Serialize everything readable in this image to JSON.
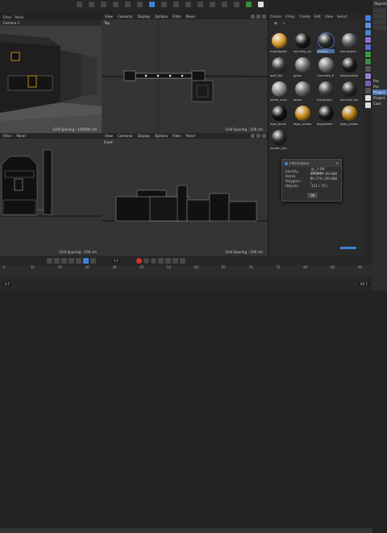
{
  "menubar": {
    "items": [
      "Filter",
      "Panel"
    ]
  },
  "viewports": [
    {
      "id": "perspective",
      "menu": [
        "Filter",
        "Panel"
      ],
      "label": "Camera 1"
    },
    {
      "id": "top",
      "menu": [
        "View",
        "Cameras",
        "Display",
        "Options",
        "Filter",
        "Panel"
      ],
      "label": "Top",
      "grid": "Grid Spacing : 100 cm"
    },
    {
      "id": "right",
      "menu": [
        "Filter",
        "Panel"
      ],
      "label": ""
    },
    {
      "id": "front",
      "menu": [
        "View",
        "Cameras",
        "Display",
        "Options",
        "Filter",
        "Panel"
      ],
      "label": "Front",
      "grid": "Grid Spacing : 100 cm"
    }
  ],
  "perspective_grid": "Grid Spacing : 100000 cm",
  "right_grid": "Grid Spacing : 100 cm",
  "material_manager": {
    "menu": [
      "Create",
      "V-Ray",
      "Create",
      "Edit",
      "View",
      "Select"
    ],
    "materials": [
      {
        "name": "metal/gold",
        "color": "#d99a2b"
      },
      {
        "name": "security_car",
        "color": "#1a1a1a"
      },
      {
        "name": "roofBot",
        "color": "#2a2a2a",
        "selected": true
      },
      {
        "name": "frame/gris",
        "color": "#555"
      },
      {
        "name": "wall_tile",
        "color": "#3b3b3b"
      },
      {
        "name": "glass",
        "color": "#6e6e6e"
      },
      {
        "name": "Concrete_fl",
        "color": "#777"
      },
      {
        "name": "black/metal",
        "color": "#1c1c1c"
      },
      {
        "name": "white_conc",
        "color": "#8a8a8a"
      },
      {
        "name": "stone",
        "color": "#6a6a6a"
      },
      {
        "name": "frame/gril",
        "color": "#444"
      },
      {
        "name": "security_ba",
        "color": "#2c2c2c"
      },
      {
        "name": "logo_black",
        "color": "#111"
      },
      {
        "name": "logo_yellow",
        "color": "#c58a1a"
      },
      {
        "name": "logo/black",
        "color": "#181818"
      },
      {
        "name": "logo_yellow",
        "color": "#b98014"
      },
      {
        "name": "screen_sec",
        "color": "#2b2b2b"
      }
    ]
  },
  "info_dialog": {
    "title": "Information",
    "rows": [
      {
        "label": "Identity",
        "value": "as_3 4M Objects"
      },
      {
        "label": "Points",
        "value": "44 890 ( 89 888 )"
      },
      {
        "label": "Polygons",
        "value": "46 279 ( 89 888 )"
      },
      {
        "label": "Objects",
        "value": "121 ( 76 )"
      }
    ],
    "ok": "OK"
  },
  "right_panel": {
    "header": "Objects",
    "tab_project": "Project",
    "items": [
      "Pro",
      "Pro",
      "Project",
      "Coor"
    ]
  },
  "timeline": {
    "ticks": [
      "0",
      "15",
      "20",
      "30",
      "40",
      "45",
      "55",
      "60",
      "65",
      "70",
      "75",
      "80",
      "85",
      "90"
    ],
    "frame_field": "0 F",
    "start": "0 F",
    "end": "90 F"
  },
  "colors": {
    "accent": "#3f7fd9",
    "selected": "#4a6ea8"
  }
}
